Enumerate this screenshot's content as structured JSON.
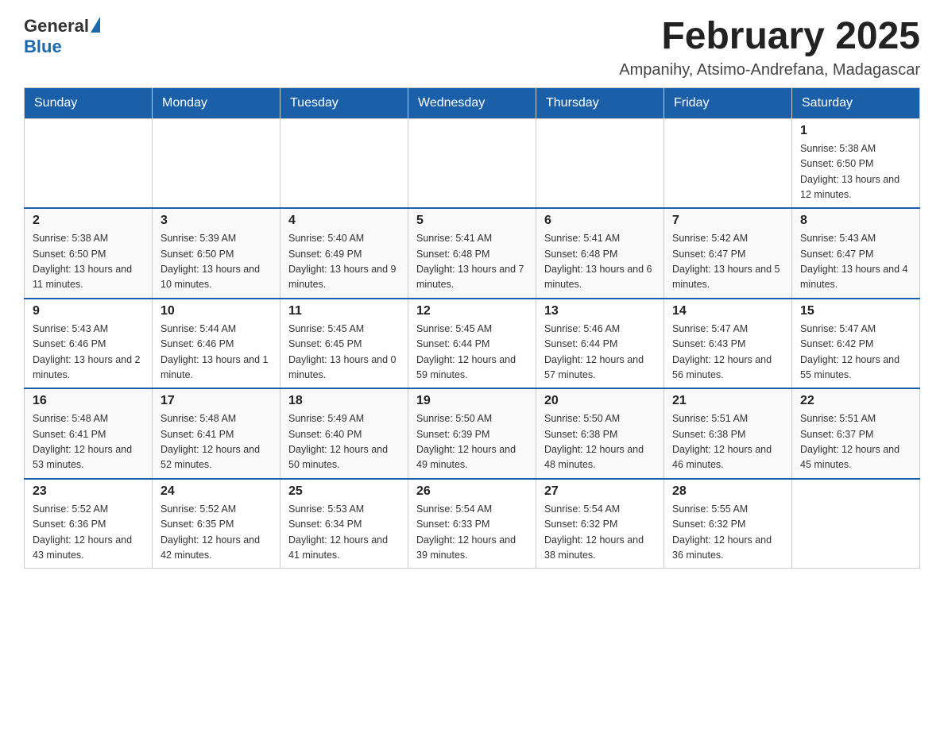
{
  "header": {
    "logo_general": "General",
    "logo_blue": "Blue",
    "month_title": "February 2025",
    "location": "Ampanihy, Atsimo-Andrefana, Madagascar"
  },
  "days_of_week": [
    "Sunday",
    "Monday",
    "Tuesday",
    "Wednesday",
    "Thursday",
    "Friday",
    "Saturday"
  ],
  "weeks": [
    {
      "days": [
        {
          "num": "",
          "info": ""
        },
        {
          "num": "",
          "info": ""
        },
        {
          "num": "",
          "info": ""
        },
        {
          "num": "",
          "info": ""
        },
        {
          "num": "",
          "info": ""
        },
        {
          "num": "",
          "info": ""
        },
        {
          "num": "1",
          "info": "Sunrise: 5:38 AM\nSunset: 6:50 PM\nDaylight: 13 hours and 12 minutes."
        }
      ]
    },
    {
      "days": [
        {
          "num": "2",
          "info": "Sunrise: 5:38 AM\nSunset: 6:50 PM\nDaylight: 13 hours and 11 minutes."
        },
        {
          "num": "3",
          "info": "Sunrise: 5:39 AM\nSunset: 6:50 PM\nDaylight: 13 hours and 10 minutes."
        },
        {
          "num": "4",
          "info": "Sunrise: 5:40 AM\nSunset: 6:49 PM\nDaylight: 13 hours and 9 minutes."
        },
        {
          "num": "5",
          "info": "Sunrise: 5:41 AM\nSunset: 6:48 PM\nDaylight: 13 hours and 7 minutes."
        },
        {
          "num": "6",
          "info": "Sunrise: 5:41 AM\nSunset: 6:48 PM\nDaylight: 13 hours and 6 minutes."
        },
        {
          "num": "7",
          "info": "Sunrise: 5:42 AM\nSunset: 6:47 PM\nDaylight: 13 hours and 5 minutes."
        },
        {
          "num": "8",
          "info": "Sunrise: 5:43 AM\nSunset: 6:47 PM\nDaylight: 13 hours and 4 minutes."
        }
      ]
    },
    {
      "days": [
        {
          "num": "9",
          "info": "Sunrise: 5:43 AM\nSunset: 6:46 PM\nDaylight: 13 hours and 2 minutes."
        },
        {
          "num": "10",
          "info": "Sunrise: 5:44 AM\nSunset: 6:46 PM\nDaylight: 13 hours and 1 minute."
        },
        {
          "num": "11",
          "info": "Sunrise: 5:45 AM\nSunset: 6:45 PM\nDaylight: 13 hours and 0 minutes."
        },
        {
          "num": "12",
          "info": "Sunrise: 5:45 AM\nSunset: 6:44 PM\nDaylight: 12 hours and 59 minutes."
        },
        {
          "num": "13",
          "info": "Sunrise: 5:46 AM\nSunset: 6:44 PM\nDaylight: 12 hours and 57 minutes."
        },
        {
          "num": "14",
          "info": "Sunrise: 5:47 AM\nSunset: 6:43 PM\nDaylight: 12 hours and 56 minutes."
        },
        {
          "num": "15",
          "info": "Sunrise: 5:47 AM\nSunset: 6:42 PM\nDaylight: 12 hours and 55 minutes."
        }
      ]
    },
    {
      "days": [
        {
          "num": "16",
          "info": "Sunrise: 5:48 AM\nSunset: 6:41 PM\nDaylight: 12 hours and 53 minutes."
        },
        {
          "num": "17",
          "info": "Sunrise: 5:48 AM\nSunset: 6:41 PM\nDaylight: 12 hours and 52 minutes."
        },
        {
          "num": "18",
          "info": "Sunrise: 5:49 AM\nSunset: 6:40 PM\nDaylight: 12 hours and 50 minutes."
        },
        {
          "num": "19",
          "info": "Sunrise: 5:50 AM\nSunset: 6:39 PM\nDaylight: 12 hours and 49 minutes."
        },
        {
          "num": "20",
          "info": "Sunrise: 5:50 AM\nSunset: 6:38 PM\nDaylight: 12 hours and 48 minutes."
        },
        {
          "num": "21",
          "info": "Sunrise: 5:51 AM\nSunset: 6:38 PM\nDaylight: 12 hours and 46 minutes."
        },
        {
          "num": "22",
          "info": "Sunrise: 5:51 AM\nSunset: 6:37 PM\nDaylight: 12 hours and 45 minutes."
        }
      ]
    },
    {
      "days": [
        {
          "num": "23",
          "info": "Sunrise: 5:52 AM\nSunset: 6:36 PM\nDaylight: 12 hours and 43 minutes."
        },
        {
          "num": "24",
          "info": "Sunrise: 5:52 AM\nSunset: 6:35 PM\nDaylight: 12 hours and 42 minutes."
        },
        {
          "num": "25",
          "info": "Sunrise: 5:53 AM\nSunset: 6:34 PM\nDaylight: 12 hours and 41 minutes."
        },
        {
          "num": "26",
          "info": "Sunrise: 5:54 AM\nSunset: 6:33 PM\nDaylight: 12 hours and 39 minutes."
        },
        {
          "num": "27",
          "info": "Sunrise: 5:54 AM\nSunset: 6:32 PM\nDaylight: 12 hours and 38 minutes."
        },
        {
          "num": "28",
          "info": "Sunrise: 5:55 AM\nSunset: 6:32 PM\nDaylight: 12 hours and 36 minutes."
        },
        {
          "num": "",
          "info": ""
        }
      ]
    }
  ]
}
